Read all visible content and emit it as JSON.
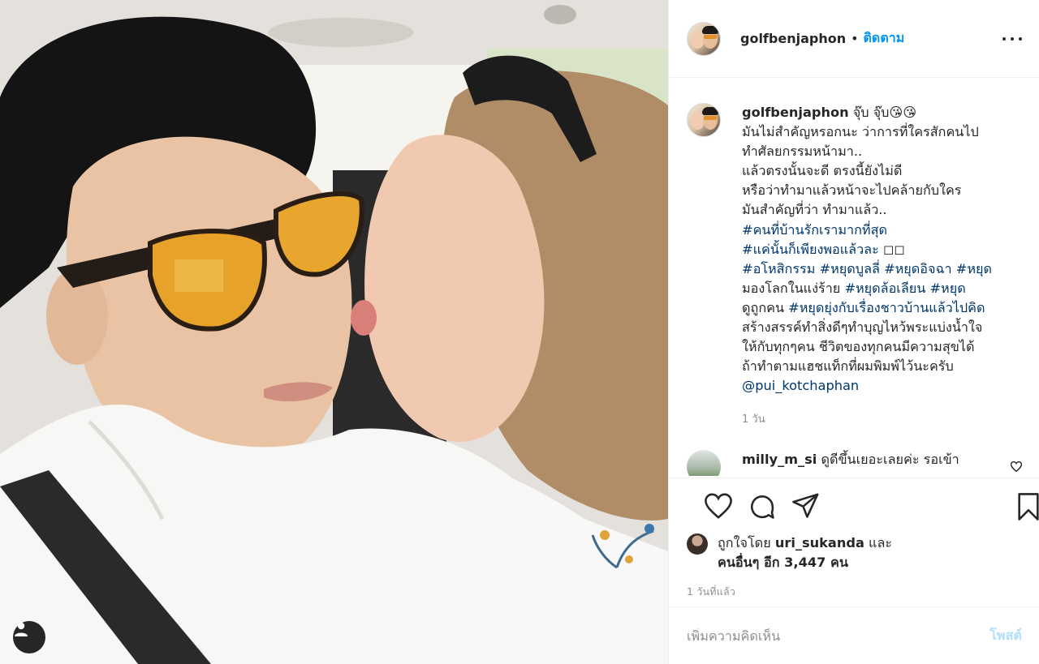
{
  "colors": {
    "accent": "#0095f6",
    "hashtag": "#00376b",
    "muted": "#8e8e8e",
    "post_disabled": "#b2dffc"
  },
  "photo": {
    "user_tag_icon": "person-icon"
  },
  "header": {
    "username": "golfbenjaphon",
    "separator": "•",
    "follow_label": "ติดตาม",
    "more_icon": "more-horizontal-icon"
  },
  "caption": {
    "username": "golfbenjaphon",
    "lines_plain": " จุ๊บ จุ๊บ😘😘\nมันไม่สำคัญหรอกนะ ว่าการที่ใครสักคนไป\nทำศัลยกรรมหน้ามา..\nแล้วตรงนั้นจะดี ตรงนี้ยังไม่ดี\nหรือว่าทำมาแล้วหน้าจะไปคล้ายกับใคร\nมันสำคัญที่ว่า ทำมาแล้ว..",
    "tags": [
      "#คนที่บ้านรักเรามากที่สุด",
      "#แค่นั้นก็เพียงพอแล้วละ",
      "#อโหสิกรรม",
      "#หยุดบูลลี่",
      "#หยุดอิจฉา",
      "#หยุด",
      "#หยุดล้อเลียน",
      "#หยุด",
      "#หยุดยุ่งกับเรื่องชาวบ้านแล้วไปคิด"
    ],
    "tag_line2_suffix": " ◻◻",
    "text_mongloke": "มองโลกในแง่ร้าย ",
    "text_dukuk": "ดูถูกคน ",
    "text_tail": "สร้างสรรค์ทำสิ่งดีๆทำบุญไหว้พระแบ่งน้ำใจ\nให้กับทุกๆคน ชีวิตของทุกคนมีความสุขได้\nถ้าทำตามแฮชแท็กที่ผมพิมพ์ไว้นะครับ",
    "mention": "@pui_kotchaphan",
    "time": "1 วัน"
  },
  "comments": [
    {
      "username": "milly_m_si",
      "text": "ดูดีขึ้นเยอะเลยค่ะ รอเข้า"
    }
  ],
  "actions": {
    "like_icon": "heart-icon",
    "comment_icon": "comment-icon",
    "share_icon": "paper-plane-icon",
    "save_icon": "bookmark-icon"
  },
  "likes": {
    "prefix": "ถูกใจโดย ",
    "user": "uri_sukanda",
    "and": " และ",
    "others": "คนอื่นๆ อีก 3,447 คน"
  },
  "post_time": "1 วันที่แล้ว",
  "add_comment": {
    "placeholder": "เพิ่มความคิดเห็น",
    "post_label": "โพสต์"
  }
}
